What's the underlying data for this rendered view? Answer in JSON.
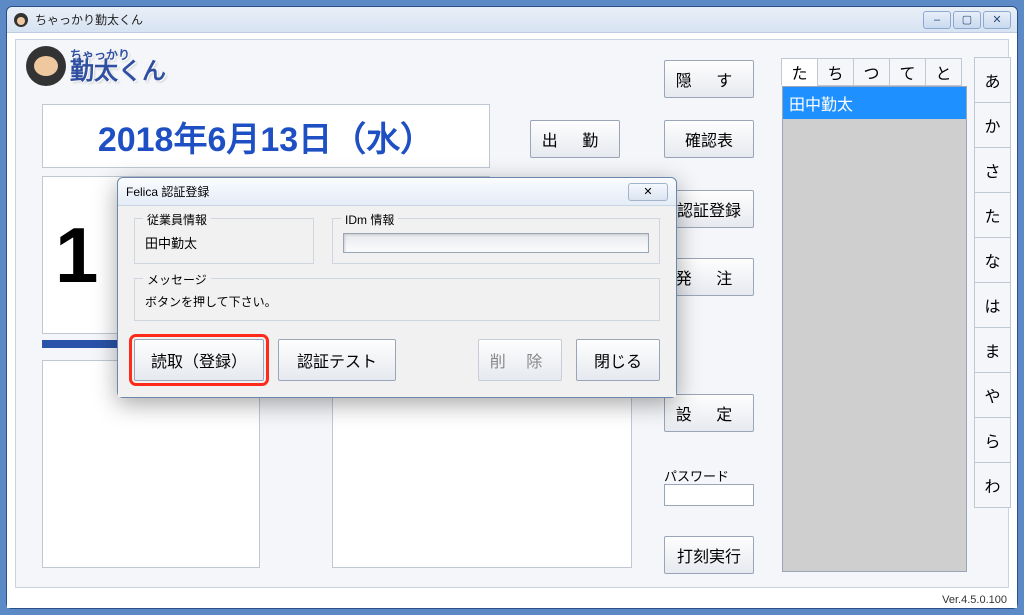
{
  "window": {
    "title": "ちゃっかり勤太くん",
    "logo_top": "ちゃっかり",
    "logo_main": "勤太くん"
  },
  "date_text": "2018年6月13日（水）",
  "clock_partial": "1",
  "buttons": {
    "hide": "隠 す",
    "attend": "出 勤",
    "confirm": "確認表",
    "auth_reg": "認証登録",
    "order": "発 注",
    "settings": "設 定",
    "exec": "打刻実行"
  },
  "password": {
    "label": "パスワード",
    "value": ""
  },
  "kana_top": [
    "た",
    "ち",
    "つ",
    "て",
    "と"
  ],
  "kana_side": [
    "あ",
    "か",
    "さ",
    "た",
    "な",
    "は",
    "ま",
    "や",
    "ら",
    "わ"
  ],
  "name_list": {
    "selected": "田中勤太"
  },
  "modal": {
    "title": "Felica 認証登録",
    "emp_legend": "従業員情報",
    "emp_name": "田中勤太",
    "idm_legend": "IDm 情報",
    "idm_value": "",
    "msg_legend": "メッセージ",
    "msg_text": "ボタンを押して下さい。",
    "btn_read": "読取（登録）",
    "btn_test": "認証テスト",
    "btn_delete": "削 除",
    "btn_close": "閉じる"
  },
  "version": "Ver.4.5.0.100"
}
